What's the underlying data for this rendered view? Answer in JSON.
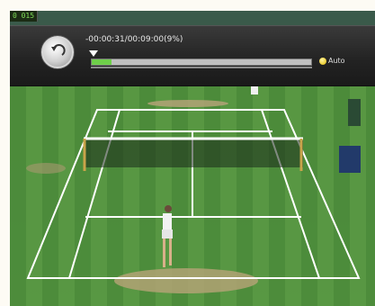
{
  "player": {
    "counter": "0 015",
    "time_text": "-00:00:31/00:09:00(9%)",
    "progress_fraction": 0.09,
    "auto_label": "Auto"
  },
  "icons": {
    "back": "undo-arrow-icon",
    "seek": "seek-marker-icon",
    "auto": "yellow-dot-icon"
  },
  "colors": {
    "grass": "#3a7a30",
    "progress": "#6fcf4a",
    "court_lines": "#ffffff"
  }
}
